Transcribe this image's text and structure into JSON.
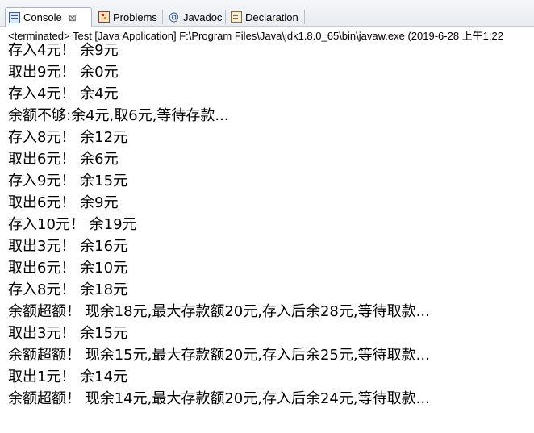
{
  "tabs": [
    {
      "label": "Console",
      "icon": "console-icon",
      "active": true,
      "close": "⊠"
    },
    {
      "label": "Problems",
      "icon": "problems-icon",
      "active": false
    },
    {
      "label": "Javadoc",
      "icon": "javadoc-at-icon",
      "active": false,
      "glyph": "@"
    },
    {
      "label": "Declaration",
      "icon": "declaration-icon",
      "active": false
    }
  ],
  "status": "<terminated> Test [Java Application] F:\\Program Files\\Java\\jdk1.8.0_65\\bin\\javaw.exe (2019-6-28 上午1:22",
  "output_lines": [
    "存入4元！ 余9元",
    "取出9元！ 余0元",
    "存入4元！ 余4元",
    "余额不够:余4元,取6元,等待存款...",
    "存入8元！ 余12元",
    "取出6元！ 余6元",
    "存入9元！ 余15元",
    "取出6元！ 余9元",
    "存入10元！ 余19元",
    "取出3元！ 余16元",
    "取出6元！ 余10元",
    "存入8元！ 余18元",
    "余额超额！ 现余18元,最大存款额20元,存入后余28元,等待取款...",
    "取出3元！ 余15元",
    "余额超额！ 现余15元,最大存款额20元,存入后余25元,等待取款...",
    "取出1元！ 余14元",
    "余额超额！ 现余14元,最大存款额20元,存入后余24元,等待取款..."
  ]
}
